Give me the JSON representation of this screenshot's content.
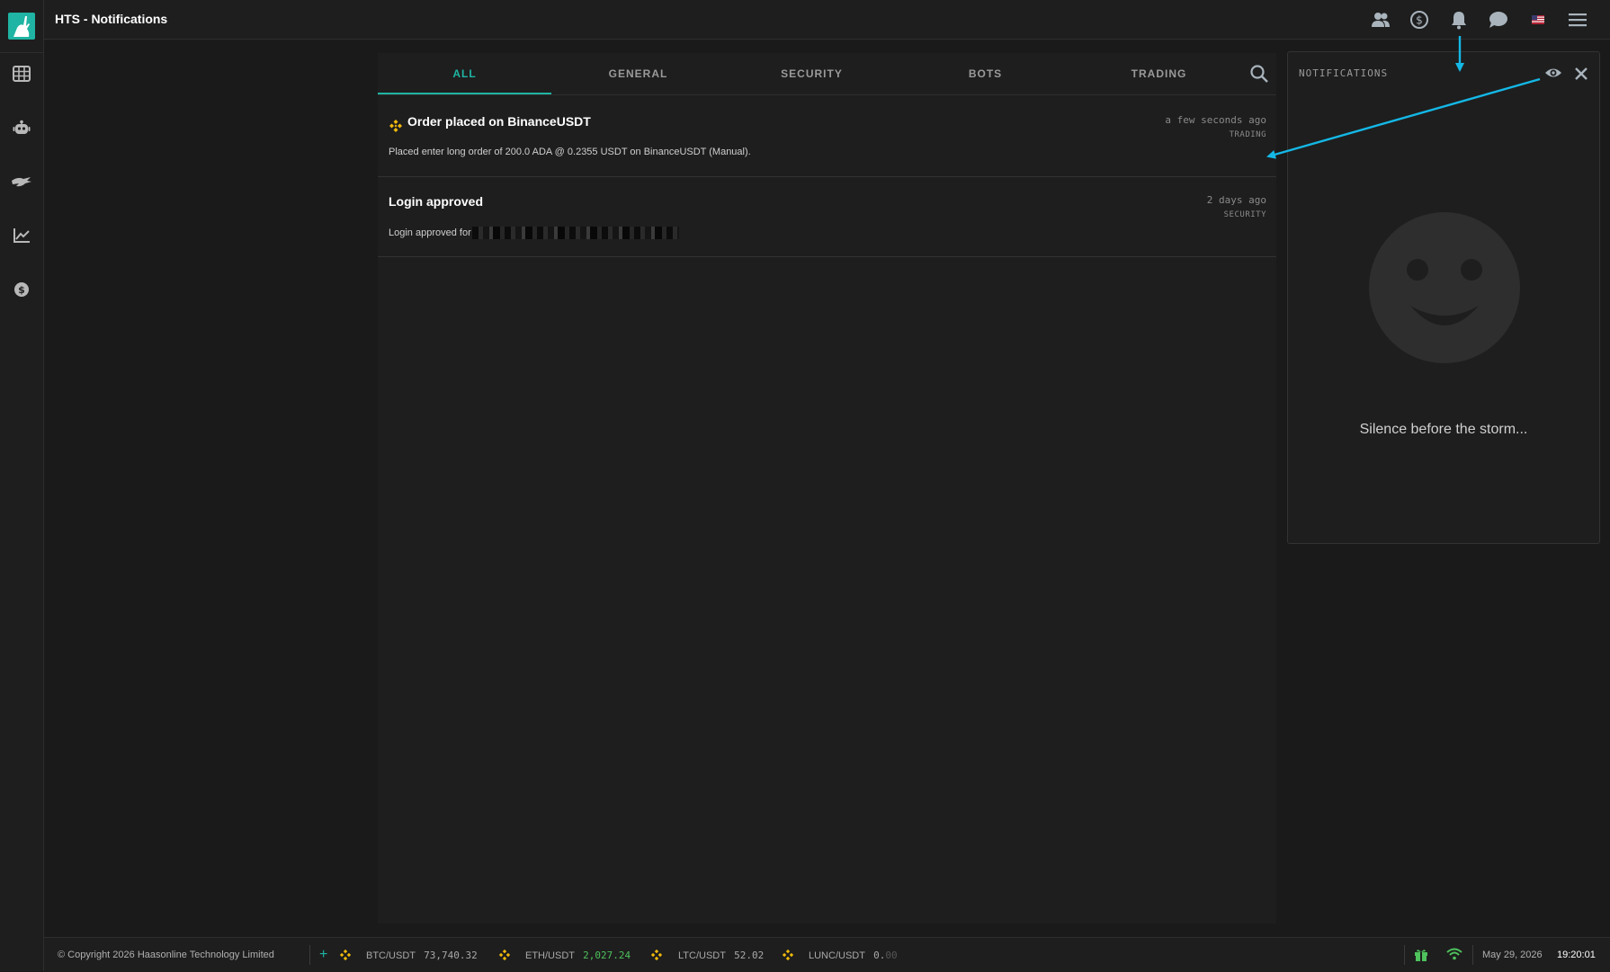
{
  "app": {
    "title": "HTS - Notifications"
  },
  "tabs": [
    {
      "label": "ALL",
      "active": true
    },
    {
      "label": "GENERAL",
      "active": false
    },
    {
      "label": "SECURITY",
      "active": false
    },
    {
      "label": "BOTS",
      "active": false
    },
    {
      "label": "TRADING",
      "active": false
    }
  ],
  "notifications": [
    {
      "title": "Order placed on BinanceUSDT",
      "body": "Placed enter long order of 200.0 ADA @ 0.2355 USDT on BinanceUSDT (Manual).",
      "time": "a few seconds ago",
      "category": "TRADING",
      "icon": "binance-icon"
    },
    {
      "title": "Login approved",
      "body": "Login approved for",
      "time": "2 days ago",
      "category": "SECURITY"
    }
  ],
  "popup": {
    "title": "NOTIFICATIONS",
    "empty_message": "Silence before the storm..."
  },
  "footer": {
    "copyright": "© Copyright 2026 Haasonline Technology Limited",
    "tickers": [
      {
        "pair": "BTC/USDT",
        "price": "73,740.32",
        "trend": "neutral"
      },
      {
        "pair": "ETH/USDT",
        "price": "2,027.24",
        "trend": "up"
      },
      {
        "pair": "LTC/USDT",
        "price": "52.02",
        "trend": "neutral"
      },
      {
        "pair": "LUNC/USDT",
        "price_main": "0.",
        "price_dim": "00",
        "trend": "neutral"
      }
    ],
    "date": "May 29, 2026",
    "time": "19:20:01"
  },
  "colors": {
    "accent": "#1fb4a3",
    "binance": "#f0b90b",
    "price_up": "#4ec25d",
    "annotation_arrow": "#14b8e6"
  }
}
